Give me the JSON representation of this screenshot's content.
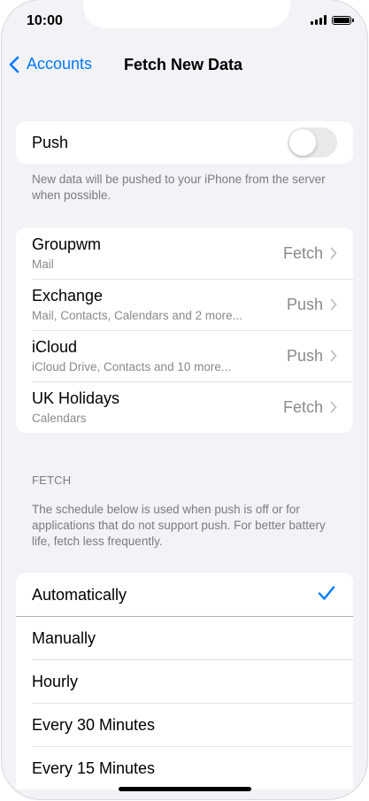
{
  "status": {
    "time": "10:00"
  },
  "nav": {
    "back_label": "Accounts",
    "title": "Fetch New Data"
  },
  "push": {
    "label": "Push",
    "enabled": false,
    "footnote": "New data will be pushed to your iPhone from the server when possible."
  },
  "accounts": [
    {
      "name": "Groupwm",
      "detail": "Mail",
      "mode": "Fetch"
    },
    {
      "name": "Exchange",
      "detail": "Mail, Contacts, Calendars and 2 more...",
      "mode": "Push"
    },
    {
      "name": "iCloud",
      "detail": "iCloud Drive, Contacts and 10 more...",
      "mode": "Push"
    },
    {
      "name": "UK Holidays",
      "detail": "Calendars",
      "mode": "Fetch"
    }
  ],
  "fetch": {
    "header": "FETCH",
    "description": "The schedule below is used when push is off or for applications that do not support push. For better battery life, fetch less frequently.",
    "options": [
      "Automatically",
      "Manually",
      "Hourly",
      "Every 30 Minutes",
      "Every 15 Minutes"
    ],
    "selected": "Automatically"
  },
  "colors": {
    "accent": "#007aff",
    "background": "#f2f2f7",
    "secondary_text": "#8a8a8e"
  }
}
